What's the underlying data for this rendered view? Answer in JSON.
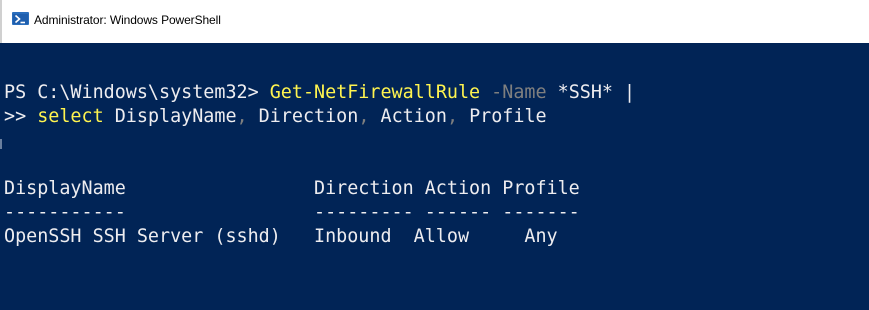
{
  "window": {
    "title": "Administrator: Windows PowerShell",
    "icon": "powershell-icon"
  },
  "console": {
    "background": "#012456",
    "prompt": "PS C:\\Windows\\system32> ",
    "command_name": "Get-NetFirewallRule",
    "param_name": " -Name",
    "param_value": " *SSH* |",
    "continuation_prompt": ">> ",
    "pipe_command": "select",
    "args": [
      {
        "text": " DisplayName",
        "sep": ","
      },
      {
        "text": " Direction",
        "sep": ","
      },
      {
        "text": " Action",
        "sep": ","
      },
      {
        "text": " Profile",
        "sep": ""
      }
    ],
    "table": {
      "headers": [
        "DisplayName",
        "Direction",
        "Action",
        "Profile"
      ],
      "header_line": "DisplayName                 Direction Action Profile",
      "separator_line": "-----------                 --------- ------ -------",
      "rows": [
        {
          "DisplayName": "OpenSSH SSH Server (sshd)",
          "Direction": "Inbound",
          "Action": "Allow",
          "Profile": "Any",
          "line": "OpenSSH SSH Server (sshd)   Inbound  Allow     Any"
        }
      ]
    }
  }
}
